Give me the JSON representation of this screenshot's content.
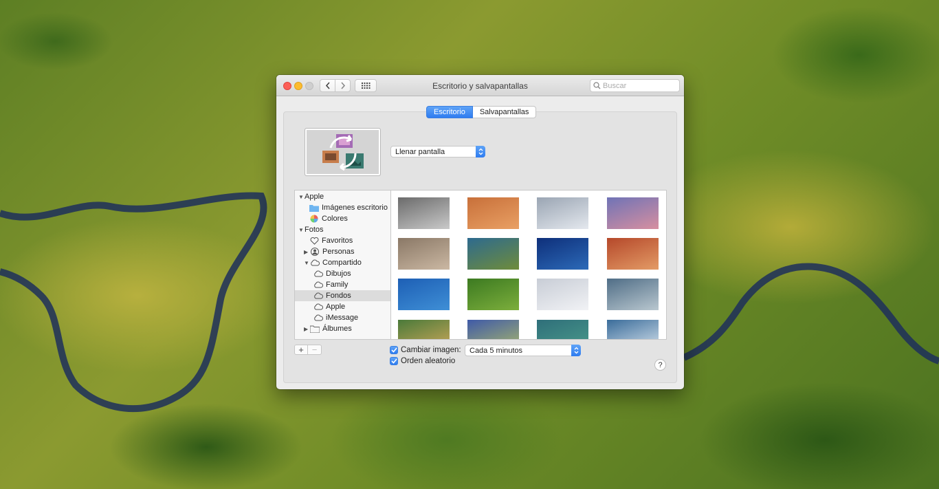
{
  "window": {
    "title": "Escritorio y salvapantallas",
    "search_placeholder": "Buscar"
  },
  "tabs": [
    {
      "label": "Escritorio",
      "active": true
    },
    {
      "label": "Salvapantallas",
      "active": false
    }
  ],
  "fill_mode": "Llenar pantalla",
  "sidebar": {
    "items": [
      {
        "label": "Apple",
        "icon": "disclosure-open"
      },
      {
        "label": "Imágenes escritorio",
        "icon": "folder-icon"
      },
      {
        "label": "Colores",
        "icon": "color-wheel-icon"
      },
      {
        "label": "Fotos",
        "icon": "disclosure-open"
      },
      {
        "label": "Favoritos",
        "icon": "heart-icon"
      },
      {
        "label": "Personas",
        "icon": "person-icon"
      },
      {
        "label": "Compartido",
        "icon": "cloud-icon"
      },
      {
        "label": "Dibujos",
        "icon": "cloud-icon"
      },
      {
        "label": "Family",
        "icon": "cloud-icon"
      },
      {
        "label": "Fondos",
        "icon": "cloud-icon",
        "selected": true
      },
      {
        "label": "Apple",
        "icon": "cloud-icon"
      },
      {
        "label": "iMessage",
        "icon": "cloud-icon"
      },
      {
        "label": "Álbumes",
        "icon": "folder-icon"
      }
    ]
  },
  "thumbnail_colors": [
    [
      "#6b6b6b",
      "#c9c9c9"
    ],
    [
      "#c8703a",
      "#e9a064"
    ],
    [
      "#9aa5b3",
      "#e4e8ee"
    ],
    [
      "#6f73b6",
      "#d78fa0"
    ],
    [
      "#8a7866",
      "#cbb8a3"
    ],
    [
      "#2d6a8f",
      "#6f8c3a"
    ],
    [
      "#0e2f7a",
      "#2c6ab8"
    ],
    [
      "#b5482a",
      "#e39b66"
    ],
    [
      "#1d5fb5",
      "#3f8fd6"
    ],
    [
      "#3c7a21",
      "#7cae3c"
    ],
    [
      "#c8cdd6",
      "#f1f2f5"
    ],
    [
      "#4f6d86",
      "#b9c7cf"
    ],
    [
      "#4a7a3a",
      "#d0a85a"
    ],
    [
      "#3f5aa8",
      "#aab86a"
    ],
    [
      "#2f6f7a",
      "#4a9a8a"
    ],
    [
      "#3a6c9a",
      "#d8e4ee"
    ]
  ],
  "change_picture": {
    "label": "Cambiar imagen:",
    "checked": true,
    "interval": "Cada 5 minutos"
  },
  "random_order": {
    "label": "Orden aleatorio",
    "checked": true
  },
  "buttons": {
    "add": "+",
    "remove": "−",
    "help": "?"
  }
}
